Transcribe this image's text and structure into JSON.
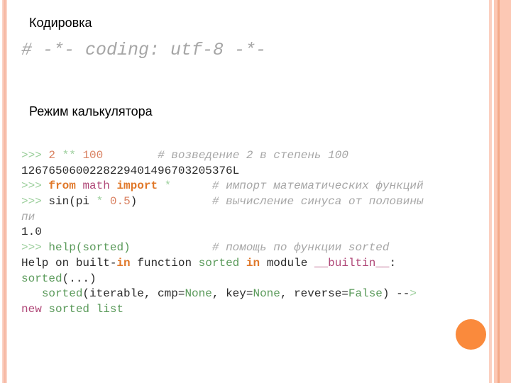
{
  "headings": {
    "encoding": "Кодировка",
    "calculator": "Режим калькулятора"
  },
  "coding_line": "# -*- coding: utf-8 -*-",
  "code": {
    "prompt": ">>>",
    "l1": {
      "a": "2",
      "op": "**",
      "b": "100",
      "comment": "# возведение 2 в степень 100"
    },
    "l2": {
      "out": "126765060022822940149670320537 6L"
    },
    "l3": {
      "kw1": "from",
      "mod": "math",
      "kw2": "import",
      "star": "*",
      "comment": "# импорт математических функций"
    },
    "l4": {
      "fn": "sin(pi",
      "op": "*",
      "num": "0.5",
      "close": ")",
      "comment": "# вычисление синуса от половины"
    },
    "l5": {
      "cont": "пи"
    },
    "l6": {
      "out": "1.0"
    },
    "l7": {
      "fn": "help(sorted)",
      "comment": "# помощь по функции sorted"
    },
    "l8": {
      "a": "Help on built-",
      "kw": "in",
      "b": "function",
      "fn": "sorted",
      "kw2": "in",
      "c": "module",
      "mod": "__builtin__",
      "d": ":"
    },
    "l9": {
      "fn": "sorted",
      "rest": "(...)"
    },
    "l10": {
      "fn": "sorted",
      "a": "(iterable, cmp=",
      "none1": "None",
      "b": ", key=",
      "none2": "None",
      "c": ", reverse=",
      "false": "False",
      "d": ") --",
      "arrow": ">"
    },
    "l11": {
      "new": "new",
      "rest": "sorted list"
    }
  },
  "colors": {
    "accent_circle": "#fa8a3c",
    "border_stripe": "#fcc8b4"
  }
}
